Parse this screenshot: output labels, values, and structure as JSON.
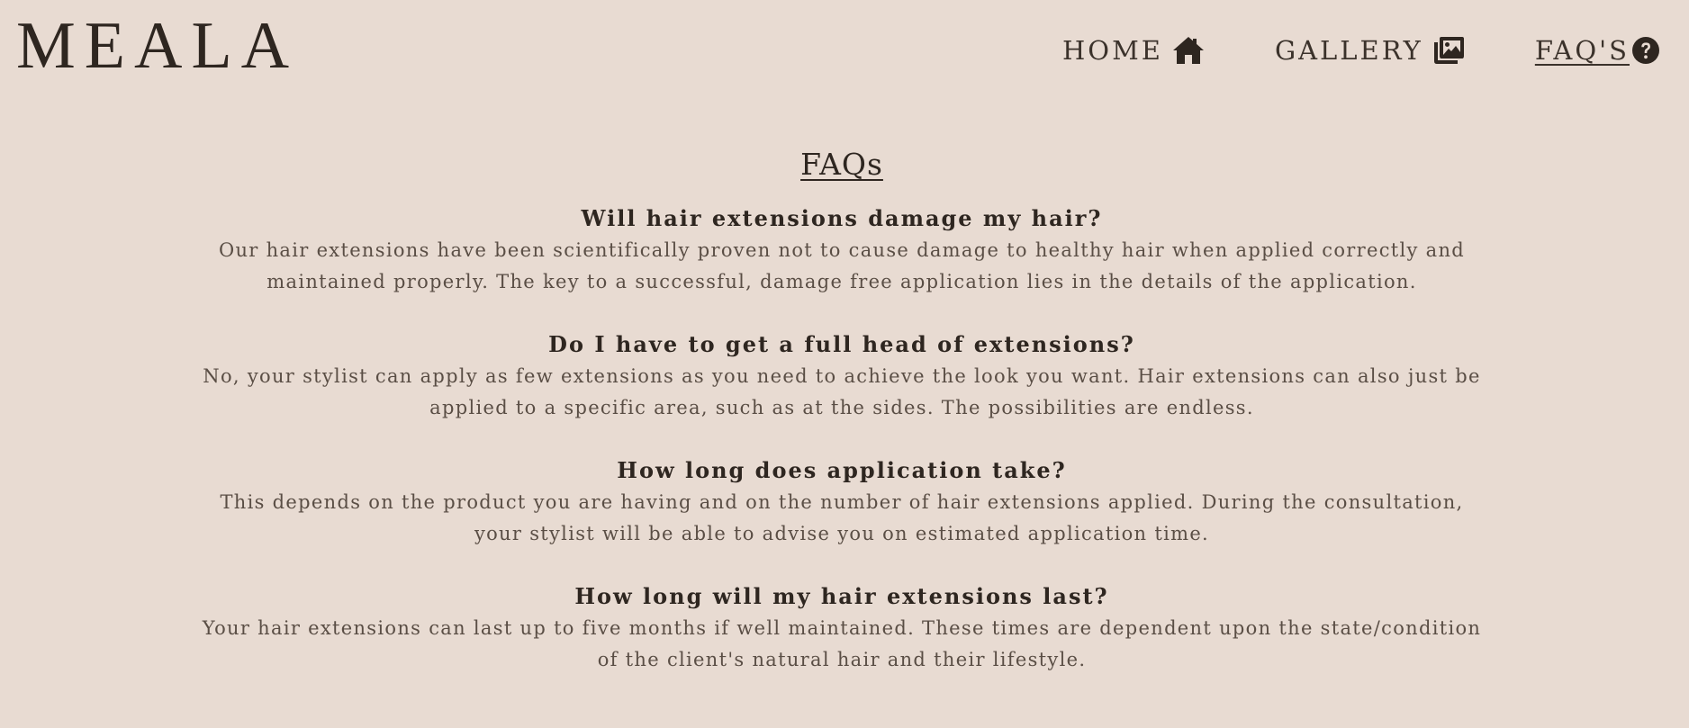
{
  "header": {
    "logo": "MEALA",
    "nav": [
      {
        "label": "HOME",
        "icon": "home-icon",
        "active": false
      },
      {
        "label": "GALLERY",
        "icon": "images-icon",
        "active": false
      },
      {
        "label": "FAQ'S",
        "icon": "question-circle-icon",
        "active": true
      }
    ]
  },
  "main": {
    "title": "FAQs",
    "faqs": [
      {
        "question": "Will hair extensions damage my hair?",
        "answer": "Our hair extensions have been scientifically proven not to cause damage to healthy hair when applied correctly and maintained properly. The key to a successful, damage free application lies in the details of the application."
      },
      {
        "question": "Do I have to get a full head of extensions?",
        "answer": "No, your stylist can apply as few extensions as you need to achieve the look you want. Hair extensions can also just be applied to a specific area, such as at the sides. The possibilities are endless."
      },
      {
        "question": "How long does application take?",
        "answer": "This depends on the product you are having and on the number of hair extensions applied. During the consultation, your stylist will be able to advise you on estimated application time."
      },
      {
        "question": "How long will my hair extensions last?",
        "answer": "Your hair extensions can last up to five months if well maintained. These times are dependent upon the state/condition of the client's natural hair and their lifestyle."
      }
    ]
  },
  "colors": {
    "background": "#e8dbd2",
    "text_dark": "#2e2620",
    "text_body": "#5a4e45"
  }
}
